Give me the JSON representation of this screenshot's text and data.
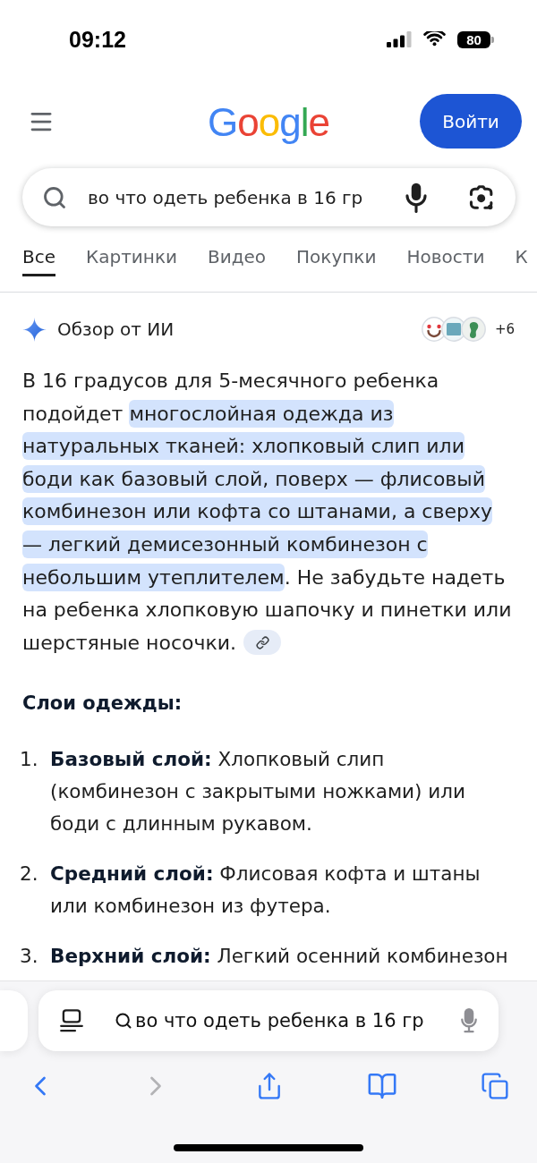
{
  "status_bar": {
    "time": "09:12",
    "battery": "80"
  },
  "header": {
    "logo": "Google",
    "sign_in_button": "Войти"
  },
  "search": {
    "value": "во что одеть ребенка в 16 гр"
  },
  "tabs": [
    {
      "label": "Все",
      "selected": true
    },
    {
      "label": "Картинки",
      "selected": false
    },
    {
      "label": "Видео",
      "selected": false
    },
    {
      "label": "Покупки",
      "selected": false
    },
    {
      "label": "Новости",
      "selected": false
    },
    {
      "label": "К",
      "selected": false
    }
  ],
  "ai_overview": {
    "title": "Обзор от ИИ",
    "more_sources": "+6",
    "paragraph": [
      {
        "text": "В 16 градусов для 5-месячного ребенка подойдет ",
        "highlighted": false
      },
      {
        "text": "многослойная одежда из натуральных тканей: хлопковый слип или боди как базовый слой, поверх — флисовый комбинезон или кофта со штанами, а сверху — легкий демисезонный комбинезон с небольшим утеплителем",
        "highlighted": true
      },
      {
        "text": ". Не забудьте надеть на ребенка хлопковую шапочку и пинетки или шерстяные носочки.",
        "highlighted": false
      }
    ],
    "subheading": "Слои одежды:",
    "list": [
      {
        "number": "1.",
        "text": "**Базовый слой:** Хлопковый слип (комбинезон с закрытыми ножками) или боди с длинным рукавом."
      },
      {
        "number": "2.",
        "text": "**Средний слой:** Флисовая кофта и штаны или комбинезон из футера."
      },
      {
        "number": "3.",
        "text": "**Верхний слой:** Легкий осенний комбинезон"
      }
    ]
  },
  "browser_bar": {
    "address": "во что одеть ребенка в 16 гр",
    "toolbar": [
      {
        "kind": "back",
        "disabled": false
      },
      {
        "kind": "forward",
        "disabled": true
      },
      {
        "kind": "share",
        "disabled": false
      },
      {
        "kind": "bookmarks",
        "disabled": false
      },
      {
        "kind": "tabs",
        "disabled": false
      }
    ]
  }
}
